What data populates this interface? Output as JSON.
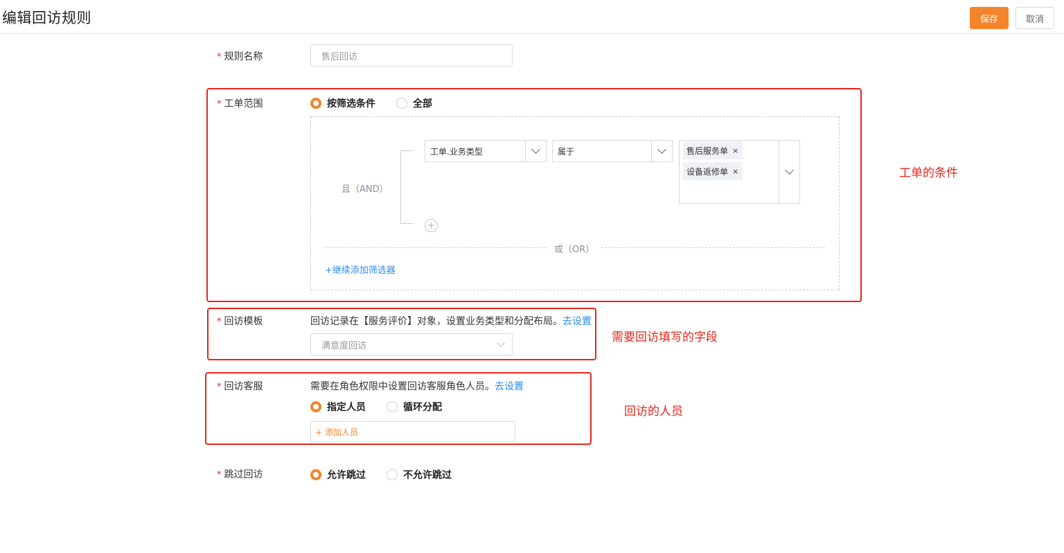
{
  "header": {
    "title": "编辑回访规则",
    "save_label": "保存",
    "cancel_label": "取消"
  },
  "form": {
    "rule_name": {
      "label": "规则名称",
      "placeholder": "售后回访"
    },
    "scope": {
      "label": "工单范围",
      "options": [
        "按筛选条件",
        "全部"
      ],
      "selected": "按筛选条件",
      "and_label": "且（AND）",
      "condition": {
        "field": "工单.业务类型",
        "operator": "属于",
        "values": [
          "售后服务单",
          "设备返修单"
        ]
      },
      "or_label": "或（OR）",
      "add_filter_label": "+继续添加筛选器"
    },
    "template": {
      "label": "回访模板",
      "helper_text": "回访记录在【服务评价】对象，设置业务类型和分配布局。",
      "helper_link": "去设置",
      "placeholder": "满意度回访"
    },
    "agent": {
      "label": "回访客服",
      "helper_text": "需要在角色权限中设置回访客服角色人员。",
      "helper_link": "去设置",
      "options": [
        "指定人员",
        "循环分配"
      ],
      "selected": "指定人员",
      "add_person_label": "+ 添加人员"
    },
    "skip": {
      "label": "跳过回访",
      "options": [
        "允许跳过",
        "不允许跳过"
      ],
      "selected": "允许跳过"
    }
  },
  "annotations": {
    "conditions": "工单的条件",
    "fields": "需要回访填写的字段",
    "people": "回访的人员",
    "color": "#e8251a"
  },
  "colors": {
    "accent": "#f5832a",
    "link": "#2d8cf0"
  }
}
